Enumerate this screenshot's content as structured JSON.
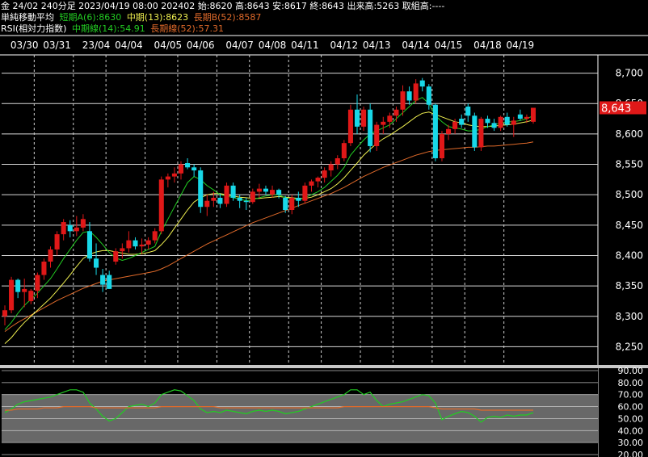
{
  "header": {
    "line1": "金 24/02 240分足 2023/04/19 08:00 202402 始:8620 高:8643 安:8617 終:8643 出来高:5263 取組高:----",
    "line2": {
      "label": "単純移動平均",
      "short": "短期A(6):8630",
      "mid": "中期(13):8623",
      "long": "長期B(52):8587"
    },
    "line3": {
      "label": "RSI(相対力指数)",
      "mid": "中期線(14):54.91",
      "long": "長期線(52):57.31"
    }
  },
  "colors": {
    "up": "#e01818",
    "down": "#18d8e8",
    "ma_short": "#22cc22",
    "ma_mid": "#f0f050",
    "ma_long": "#e06a2a",
    "rsi_mid": "#22cc22",
    "rsi_long": "#e06a2a",
    "price_tag": "#e01818"
  },
  "chart_data": [
    {
      "type": "candlestick",
      "x_labels": [
        "03/30",
        "03/31",
        "23/04",
        "04/04",
        "04/05",
        "04/06",
        "04/07",
        "04/08",
        "04/11",
        "04/12",
        "04/13",
        "04/14",
        "04/15",
        "04/18",
        "04/19"
      ],
      "y_ticks": [
        "8,700",
        "8,650",
        "8,600",
        "8,550",
        "8,500",
        "8,450",
        "8,400",
        "8,350",
        "8,300",
        "8,250"
      ],
      "ylim": [
        8220,
        8730
      ],
      "last_price_label": "8,643",
      "candles": [
        {
          "o": 8300,
          "h": 8318,
          "l": 8285,
          "c": 8310
        },
        {
          "o": 8310,
          "h": 8365,
          "l": 8305,
          "c": 8360
        },
        {
          "o": 8360,
          "h": 8362,
          "l": 8330,
          "c": 8340
        },
        {
          "o": 8340,
          "h": 8362,
          "l": 8315,
          "c": 8345
        },
        {
          "o": 8325,
          "h": 8345,
          "l": 8320,
          "c": 8342
        },
        {
          "o": 8342,
          "h": 8372,
          "l": 8330,
          "c": 8368
        },
        {
          "o": 8368,
          "h": 8395,
          "l": 8360,
          "c": 8390
        },
        {
          "o": 8390,
          "h": 8415,
          "l": 8380,
          "c": 8410
        },
        {
          "o": 8410,
          "h": 8440,
          "l": 8400,
          "c": 8435
        },
        {
          "o": 8435,
          "h": 8460,
          "l": 8425,
          "c": 8455
        },
        {
          "o": 8450,
          "h": 8458,
          "l": 8430,
          "c": 8440
        },
        {
          "o": 8440,
          "h": 8465,
          "l": 8432,
          "c": 8446
        },
        {
          "o": 8446,
          "h": 8468,
          "l": 8440,
          "c": 8460
        },
        {
          "o": 8440,
          "h": 8455,
          "l": 8390,
          "c": 8395
        },
        {
          "o": 8395,
          "h": 8420,
          "l": 8368,
          "c": 8380
        },
        {
          "o": 8368,
          "h": 8378,
          "l": 8340,
          "c": 8352
        },
        {
          "o": 8368,
          "h": 8375,
          "l": 8345,
          "c": 8345
        },
        {
          "o": 8390,
          "h": 8412,
          "l": 8385,
          "c": 8407
        },
        {
          "o": 8407,
          "h": 8420,
          "l": 8395,
          "c": 8412
        },
        {
          "o": 8412,
          "h": 8440,
          "l": 8405,
          "c": 8425
        },
        {
          "o": 8425,
          "h": 8430,
          "l": 8410,
          "c": 8415
        },
        {
          "o": 8415,
          "h": 8428,
          "l": 8402,
          "c": 8418
        },
        {
          "o": 8418,
          "h": 8430,
          "l": 8410,
          "c": 8425
        },
        {
          "o": 8425,
          "h": 8445,
          "l": 8420,
          "c": 8440
        },
        {
          "o": 8440,
          "h": 8530,
          "l": 8435,
          "c": 8525
        },
        {
          "o": 8525,
          "h": 8535,
          "l": 8512,
          "c": 8530
        },
        {
          "o": 8530,
          "h": 8545,
          "l": 8520,
          "c": 8535
        },
        {
          "o": 8535,
          "h": 8555,
          "l": 8525,
          "c": 8550
        },
        {
          "o": 8552,
          "h": 8560,
          "l": 8542,
          "c": 8545
        },
        {
          "o": 8545,
          "h": 8550,
          "l": 8530,
          "c": 8540
        },
        {
          "o": 8540,
          "h": 8545,
          "l": 8470,
          "c": 8480
        },
        {
          "o": 8480,
          "h": 8500,
          "l": 8465,
          "c": 8490
        },
        {
          "o": 8490,
          "h": 8505,
          "l": 8480,
          "c": 8495
        },
        {
          "o": 8495,
          "h": 8502,
          "l": 8478,
          "c": 8485
        },
        {
          "o": 8485,
          "h": 8520,
          "l": 8480,
          "c": 8515
        },
        {
          "o": 8515,
          "h": 8520,
          "l": 8490,
          "c": 8495
        },
        {
          "o": 8495,
          "h": 8500,
          "l": 8478,
          "c": 8490
        },
        {
          "o": 8490,
          "h": 8495,
          "l": 8475,
          "c": 8488
        },
        {
          "o": 8488,
          "h": 8510,
          "l": 8485,
          "c": 8505
        },
        {
          "o": 8505,
          "h": 8518,
          "l": 8495,
          "c": 8510
        },
        {
          "o": 8510,
          "h": 8515,
          "l": 8500,
          "c": 8505
        },
        {
          "o": 8500,
          "h": 8515,
          "l": 8495,
          "c": 8508
        },
        {
          "o": 8508,
          "h": 8510,
          "l": 8494,
          "c": 8500
        },
        {
          "o": 8495,
          "h": 8498,
          "l": 8470,
          "c": 8475
        },
        {
          "o": 8475,
          "h": 8500,
          "l": 8468,
          "c": 8495
        },
        {
          "o": 8495,
          "h": 8505,
          "l": 8480,
          "c": 8490
        },
        {
          "o": 8490,
          "h": 8520,
          "l": 8485,
          "c": 8515
        },
        {
          "o": 8515,
          "h": 8525,
          "l": 8505,
          "c": 8522
        },
        {
          "o": 8522,
          "h": 8530,
          "l": 8512,
          "c": 8528
        },
        {
          "o": 8528,
          "h": 8545,
          "l": 8520,
          "c": 8540
        },
        {
          "o": 8540,
          "h": 8555,
          "l": 8530,
          "c": 8550
        },
        {
          "o": 8550,
          "h": 8565,
          "l": 8542,
          "c": 8560
        },
        {
          "o": 8560,
          "h": 8590,
          "l": 8555,
          "c": 8585
        },
        {
          "o": 8585,
          "h": 8648,
          "l": 8580,
          "c": 8640
        },
        {
          "o": 8640,
          "h": 8665,
          "l": 8600,
          "c": 8612
        },
        {
          "o": 8612,
          "h": 8645,
          "l": 8605,
          "c": 8640
        },
        {
          "o": 8640,
          "h": 8650,
          "l": 8570,
          "c": 8580
        },
        {
          "o": 8580,
          "h": 8620,
          "l": 8572,
          "c": 8615
        },
        {
          "o": 8615,
          "h": 8628,
          "l": 8600,
          "c": 8620
        },
        {
          "o": 8620,
          "h": 8635,
          "l": 8610,
          "c": 8630
        },
        {
          "o": 8630,
          "h": 8645,
          "l": 8620,
          "c": 8640
        },
        {
          "o": 8640,
          "h": 8680,
          "l": 8630,
          "c": 8670
        },
        {
          "o": 8670,
          "h": 8678,
          "l": 8648,
          "c": 8655
        },
        {
          "o": 8655,
          "h": 8690,
          "l": 8650,
          "c": 8683
        },
        {
          "o": 8688,
          "h": 8692,
          "l": 8670,
          "c": 8678
        },
        {
          "o": 8678,
          "h": 8682,
          "l": 8640,
          "c": 8648
        },
        {
          "o": 8648,
          "h": 8650,
          "l": 8555,
          "c": 8560
        },
        {
          "o": 8560,
          "h": 8605,
          "l": 8555,
          "c": 8600
        },
        {
          "o": 8600,
          "h": 8615,
          "l": 8590,
          "c": 8608
        },
        {
          "o": 8608,
          "h": 8625,
          "l": 8600,
          "c": 8620
        },
        {
          "o": 8625,
          "h": 8632,
          "l": 8610,
          "c": 8615
        },
        {
          "o": 8645,
          "h": 8650,
          "l": 8620,
          "c": 8630
        },
        {
          "o": 8630,
          "h": 8635,
          "l": 8572,
          "c": 8578
        },
        {
          "o": 8578,
          "h": 8628,
          "l": 8572,
          "c": 8625
        },
        {
          "o": 8625,
          "h": 8630,
          "l": 8610,
          "c": 8618
        },
        {
          "o": 8618,
          "h": 8625,
          "l": 8605,
          "c": 8610
        },
        {
          "o": 8610,
          "h": 8630,
          "l": 8605,
          "c": 8628
        },
        {
          "o": 8628,
          "h": 8635,
          "l": 8612,
          "c": 8615
        },
        {
          "o": 8615,
          "h": 8628,
          "l": 8595,
          "c": 8622
        },
        {
          "o": 8632,
          "h": 8640,
          "l": 8622,
          "c": 8625
        },
        {
          "o": 8625,
          "h": 8632,
          "l": 8618,
          "c": 8628
        },
        {
          "o": 8620,
          "h": 8643,
          "l": 8617,
          "c": 8643
        }
      ],
      "ma_short_name": "短期A(6)",
      "ma_mid_name": "中期(13)",
      "ma_long_name": "長期B(52)",
      "ma_short": [
        8278,
        8290,
        8305,
        8318,
        8328,
        8338,
        8350,
        8362,
        8378,
        8395,
        8410,
        8425,
        8438,
        8440,
        8430,
        8418,
        8405,
        8396,
        8392,
        8395,
        8400,
        8405,
        8410,
        8415,
        8440,
        8460,
        8480,
        8500,
        8520,
        8530,
        8525,
        8515,
        8508,
        8500,
        8498,
        8495,
        8493,
        8490,
        8492,
        8495,
        8498,
        8500,
        8500,
        8495,
        8493,
        8492,
        8495,
        8500,
        8505,
        8512,
        8522,
        8532,
        8545,
        8565,
        8578,
        8590,
        8600,
        8605,
        8610,
        8615,
        8625,
        8635,
        8645,
        8655,
        8660,
        8650,
        8630,
        8620,
        8612,
        8610,
        8608,
        8605,
        8605,
        8608,
        8612,
        8615,
        8618,
        8620,
        8620,
        8622,
        8625,
        8630
      ],
      "ma_mid": [
        8255,
        8265,
        8278,
        8290,
        8300,
        8310,
        8320,
        8330,
        8342,
        8355,
        8368,
        8382,
        8395,
        8402,
        8406,
        8408,
        8408,
        8406,
        8404,
        8402,
        8402,
        8403,
        8405,
        8408,
        8418,
        8430,
        8445,
        8460,
        8475,
        8488,
        8495,
        8500,
        8502,
        8502,
        8500,
        8498,
        8496,
        8495,
        8494,
        8494,
        8495,
        8496,
        8497,
        8496,
        8495,
        8494,
        8494,
        8496,
        8500,
        8505,
        8510,
        8518,
        8528,
        8540,
        8552,
        8565,
        8575,
        8584,
        8592,
        8598,
        8605,
        8612,
        8620,
        8628,
        8634,
        8636,
        8632,
        8628,
        8624,
        8620,
        8618,
        8615,
        8613,
        8612,
        8612,
        8613,
        8614,
        8615,
        8616,
        8618,
        8620,
        8623
      ],
      "ma_long": [
        8275,
        8283,
        8290,
        8296,
        8302,
        8308,
        8314,
        8320,
        8326,
        8331,
        8336,
        8341,
        8346,
        8350,
        8354,
        8358,
        8360,
        8362,
        8364,
        8366,
        8368,
        8370,
        8372,
        8374,
        8378,
        8383,
        8389,
        8395,
        8401,
        8407,
        8413,
        8419,
        8424,
        8429,
        8434,
        8439,
        8444,
        8449,
        8454,
        8458,
        8462,
        8466,
        8470,
        8474,
        8478,
        8482,
        8486,
        8490,
        8494,
        8498,
        8502,
        8507,
        8512,
        8518,
        8524,
        8530,
        8535,
        8540,
        8545,
        8549,
        8553,
        8557,
        8561,
        8565,
        8568,
        8571,
        8573,
        8574,
        8575,
        8576,
        8577,
        8578,
        8578,
        8579,
        8580,
        8580,
        8581,
        8582,
        8583,
        8584,
        8585,
        8587
      ]
    },
    {
      "type": "line",
      "title": "RSI",
      "y_ticks": [
        "90.00",
        "80.00",
        "70.00",
        "60.00",
        "50.00",
        "40.00",
        "30.00",
        "20.00"
      ],
      "ylim": [
        18,
        92
      ],
      "bands": [
        [
          30,
          70
        ]
      ],
      "series": [
        {
          "name": "中期線(14)",
          "values": [
            55,
            58,
            62,
            64,
            65,
            66,
            67,
            68,
            70,
            72,
            74,
            74,
            72,
            63,
            58,
            52,
            48,
            50,
            55,
            60,
            61,
            62,
            60,
            63,
            70,
            72,
            74,
            73,
            69,
            65,
            58,
            55,
            56,
            55,
            57,
            56,
            55,
            54,
            56,
            57,
            56,
            57,
            56,
            54,
            55,
            56,
            58,
            60,
            62,
            64,
            66,
            68,
            70,
            74,
            74,
            70,
            72,
            65,
            60,
            62,
            63,
            64,
            66,
            68,
            70,
            69,
            63,
            49,
            52,
            54,
            56,
            55,
            52,
            47,
            51,
            52,
            51,
            53,
            52,
            53,
            53,
            55
          ]
        },
        {
          "name": "長期線(52)",
          "values": [
            57,
            57,
            58,
            58,
            58,
            58,
            59,
            59,
            59,
            60,
            60,
            60,
            60,
            60,
            59,
            59,
            59,
            59,
            59,
            59,
            59,
            59,
            59,
            59,
            60,
            60,
            60,
            60,
            60,
            60,
            60,
            60,
            60,
            59,
            59,
            59,
            59,
            59,
            59,
            59,
            59,
            59,
            59,
            59,
            59,
            59,
            59,
            59,
            59,
            59,
            59,
            59,
            60,
            60,
            60,
            60,
            60,
            60,
            60,
            60,
            60,
            60,
            60,
            60,
            60,
            60,
            59,
            58,
            58,
            58,
            58,
            58,
            58,
            57,
            57,
            57,
            57,
            57,
            57,
            57,
            57,
            57
          ]
        }
      ]
    }
  ]
}
